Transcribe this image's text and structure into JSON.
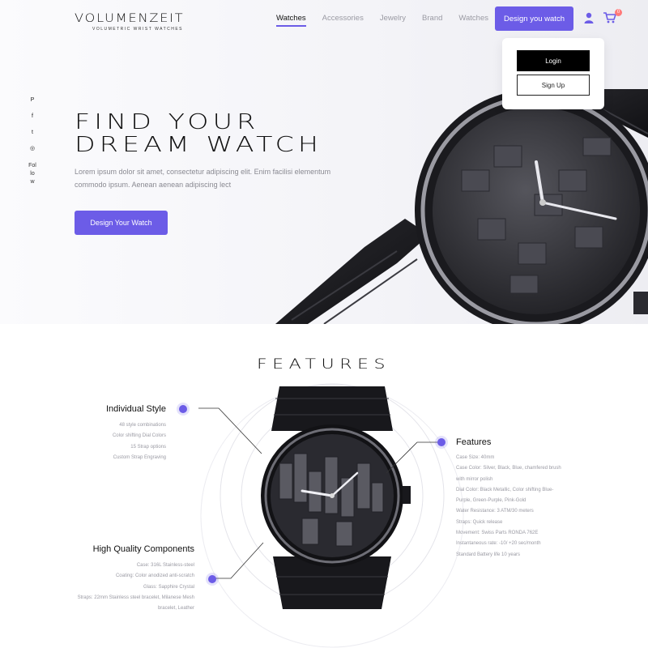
{
  "brand": {
    "name": "VOLUMENZEIT",
    "tagline": "Volumetric Wrist Watches"
  },
  "nav": {
    "items": [
      "Watches",
      "Accessories",
      "Jewelry",
      "Brand",
      "Watches"
    ],
    "active_index": 0
  },
  "header": {
    "cta_label": "Design you watch",
    "cart_count": "0",
    "icons": [
      "user-icon",
      "cart-icon"
    ]
  },
  "account_menu": {
    "login_label": "Login",
    "signup_label": "Sign Up"
  },
  "social": {
    "icons": [
      "pinterest-icon",
      "facebook-icon",
      "twitter-icon",
      "instagram-icon"
    ],
    "glyphs": [
      "P",
      "f",
      "t",
      "◎"
    ],
    "follow_text": "Follow"
  },
  "hero": {
    "title_line1": "Find your",
    "title_line2": "dream watch",
    "description": "Lorem ipsum dolor sit amet, consectetur adipiscing elit. Enim facilisi elementum commodo ipsum. Aenean aenean adipiscing lect",
    "button_label": "Design Your Watch"
  },
  "features": {
    "title": "Features",
    "individual_style": {
      "title": "Individual Style",
      "items": [
        "48 style combinations",
        "Color shifting Dial Colors",
        "15 Strap options",
        "Custom Strap Engraving"
      ]
    },
    "high_quality": {
      "title": "High Quality Components",
      "items": [
        "Case: 316L Stainless-steel",
        "Coating: Color anodized anti-scratch",
        "Glass: Sapphire Crystal",
        "Straps: 22mm Stainless steel bracelet, Milanese Mesh",
        "bracelet, Leather"
      ]
    },
    "specs": {
      "title": "Features",
      "items": [
        "Case Size: 40mm",
        "Case Color: Silver, Black, Blue, chamfered brush",
        "with mirror polish",
        "Dial Color: Black Metallic, Color shifting Blue-",
        "Purple, Green-Purple, Pink-Gold",
        "Water Resistance: 3 ATM/30 meters",
        "Straps: Quick release",
        "Movement: Swiss Parts RONDA 762E",
        "Instantaneous rate: -10/ +20 sec/month",
        "Standard Battery life 10 years"
      ]
    }
  },
  "colors": {
    "accent": "#6c5ce7",
    "badge": "#ff7a7a",
    "text_dark": "#111111",
    "text_muted": "#9a9aa3"
  }
}
